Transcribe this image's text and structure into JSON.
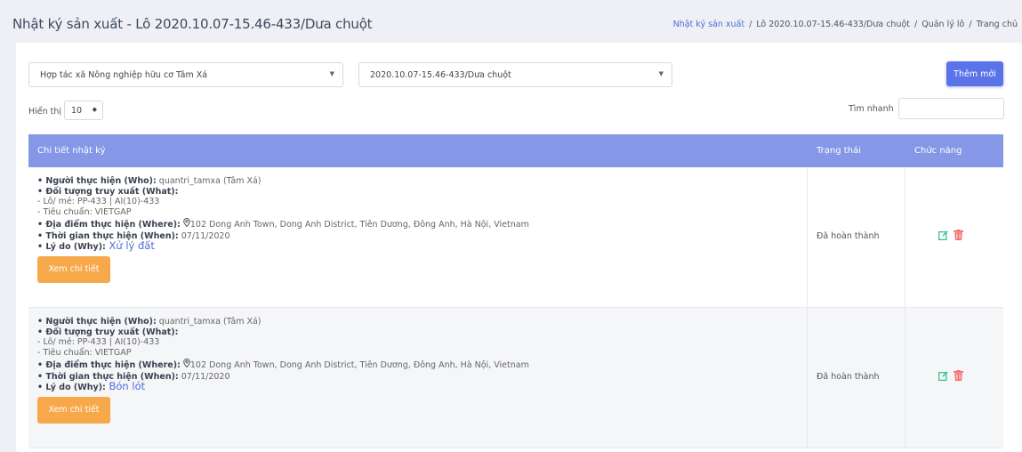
{
  "header": {
    "title": "Nhật ký sản xuất - Lô 2020.10.07-15.46-433/Dưa chuột",
    "breadcrumb": [
      {
        "label": "Nhật ký sản xuất"
      },
      {
        "label": "/"
      },
      {
        "label": "Lô 2020.10.07-15.46-433/Dưa chuột"
      },
      {
        "label": "/"
      },
      {
        "label": "Quản lý lô"
      },
      {
        "label": "/"
      },
      {
        "label": "Trang chủ"
      }
    ]
  },
  "filters": {
    "cooperative": "Hợp tác xã Nông nghiệp hữu cơ Tâm Xá",
    "lot": "2020.10.07-15.46-433/Dưa chuột",
    "add_label": "Thêm mới",
    "show_label": "Hiển thị",
    "show_value": "10",
    "search_label": "Tìm nhanh",
    "search_value": ""
  },
  "table": {
    "headers": {
      "detail": "Chi tiết nhật ký",
      "status": "Trạng thái",
      "actions": "Chức năng"
    },
    "rows": [
      {
        "who_label": "• Người thực hiện (Who):",
        "who": " quantri_tamxa (Tâm Xá)",
        "what_label": "• Đối tượng truy xuất (What):",
        "lot": "- Lô/ mẻ: PP-433 | AI(10)-433",
        "standard": "- Tiêu chuẩn: VIETGAP",
        "where_label": "• Địa điểm thực hiện (Where):",
        "where": "102 Dong Anh Town, Dong Anh District, Tiên Dương, Đông Anh, Hà Nội, Vietnam",
        "when_label": "• Thời gian thực hiện (When):",
        "when": " 07/11/2020",
        "why_label": "• Lý do (Why):",
        "why": " Xử lý đất",
        "detail_button": "Xem chi tiết",
        "status": "Đã hoàn thành"
      },
      {
        "who_label": "• Người thực hiện (Who):",
        "who": " quantri_tamxa (Tâm Xá)",
        "what_label": "• Đối tượng truy xuất (What):",
        "lot": "- Lô/ mẻ: PP-433 | AI(10)-433",
        "standard": "- Tiêu chuẩn: VIETGAP",
        "where_label": "• Địa điểm thực hiện (Where):",
        "where": "102 Dong Anh Town, Dong Anh District, Tiên Dương, Đông Anh, Hà Nội, Vietnam",
        "when_label": "• Thời gian thực hiện (When):",
        "when": " 07/11/2020",
        "why_label": "• Lý do (Why):",
        "why": " Bón lót",
        "detail_button": "Xem chi tiết",
        "status": "Đã hoàn thành"
      }
    ]
  },
  "colors": {
    "primary": "#5b73e8",
    "table_header": "#8597e6",
    "detail_button": "#f7a84a",
    "edit_icon": "#34c38f",
    "delete_icon": "#f46a6a"
  },
  "icons": [
    "location-pin-icon",
    "edit-icon",
    "delete-icon",
    "chevron-down-icon"
  ]
}
